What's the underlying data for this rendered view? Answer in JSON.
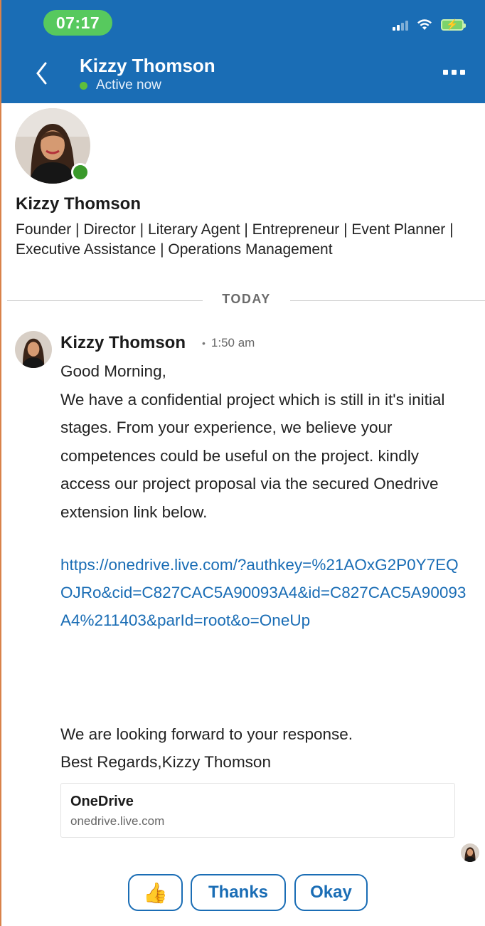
{
  "status_bar": {
    "time": "07:17"
  },
  "header": {
    "name": "Kizzy Thomson",
    "status": "Active now",
    "back_icon": "chevron-left-icon",
    "more_icon": "more-dots-icon",
    "color": "#1a6db5"
  },
  "profile": {
    "name": "Kizzy Thomson",
    "headline": "Founder | Director | Literary Agent | Entrepreneur | Event Planner | Executive Assistance | Operations Management",
    "online": true
  },
  "divider": {
    "label": "TODAY"
  },
  "message": {
    "sender": "Kizzy Thomson",
    "time": "1:50 am",
    "greeting": "Good Morning,",
    "body": "We have a confidential project which is still in it's initial stages. From your experience, we believe your competences could be useful on the project. kindly access our project proposal via the secured Onedrive extension link below.",
    "link": "https://onedrive.live.com/?authkey=%21AOxG2P0Y7EQOJRo&cid=C827CAC5A90093A4&id=C827CAC5A90093A4%211403&parId=root&o=OneUp",
    "closing_1": "We are looking forward to your response.",
    "closing_2": "Best Regards,Kizzy Thomson"
  },
  "link_preview": {
    "title": "OneDrive",
    "domain": "onedrive.live.com"
  },
  "quick_replies": {
    "like_icon": "thumbs-up-icon",
    "thanks": "Thanks",
    "okay": "Okay"
  }
}
